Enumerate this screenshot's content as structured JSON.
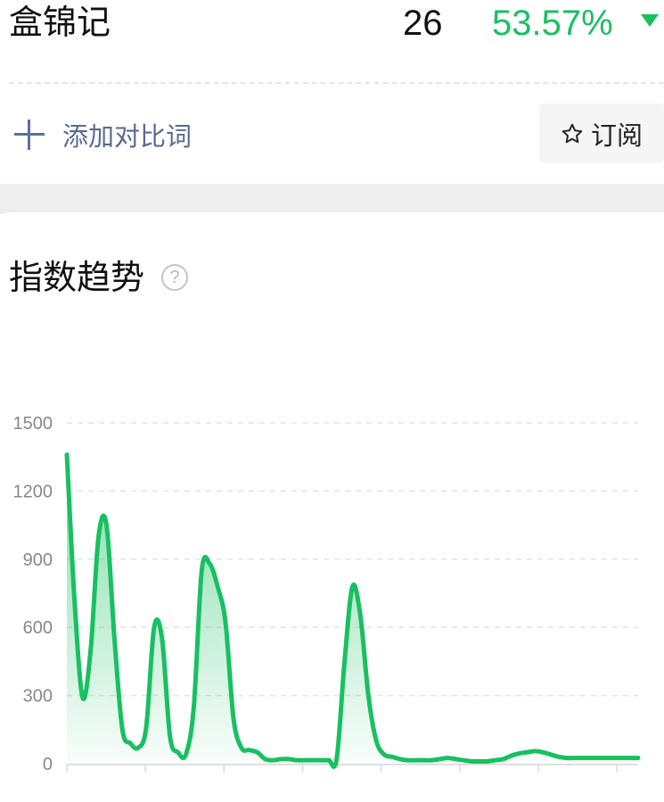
{
  "header": {
    "keyword": "盒锦记",
    "rank": "26",
    "change_percent": "53.57%",
    "trend_icon": "triangle-down-icon",
    "change_color": "#18c061"
  },
  "actions": {
    "add_compare_label": "添加对比词",
    "add_compare_icon": "plus-icon",
    "subscribe_label": "订阅",
    "subscribe_icon": "star-outline-icon"
  },
  "section": {
    "title": "指数趋势",
    "help_icon_text": "?"
  },
  "chart_data": {
    "type": "area",
    "title": "",
    "xlabel": "",
    "ylabel": "",
    "ylim": [
      0,
      1500
    ],
    "yticks": [
      "1500",
      "1200",
      "900",
      "600",
      "300",
      "0"
    ],
    "grid": true,
    "color": "#18c061",
    "x": [
      0,
      0.5,
      1,
      1.5,
      2,
      2.5,
      3,
      3.5,
      4,
      4.5,
      5,
      5.5,
      6,
      6.5,
      7,
      7.5,
      8,
      8.5,
      9,
      9.5,
      10,
      10.5,
      11,
      11.5,
      12,
      12.5,
      13,
      13.5,
      14,
      14.5,
      15,
      15.5,
      16,
      16.5,
      17,
      17.5,
      18,
      18.5,
      19,
      19.5,
      20,
      20.5,
      21,
      21.5,
      22,
      22.5,
      23,
      23.5,
      24,
      24.5,
      25,
      25.5,
      26,
      26.5,
      27,
      27.5,
      28,
      28.5,
      29,
      29.5,
      30,
      30.5,
      31,
      31.5,
      32,
      32.5,
      33,
      33.5,
      34,
      34.5,
      35,
      35.5,
      36
    ],
    "series": [
      {
        "values": [
          1360,
          700,
          290,
          500,
          1000,
          1050,
          550,
          150,
          90,
          70,
          160,
          600,
          550,
          120,
          50,
          40,
          250,
          850,
          880,
          780,
          620,
          200,
          70,
          60,
          50,
          20,
          15,
          20,
          20,
          15,
          15,
          15,
          15,
          15,
          20,
          450,
          780,
          650,
          300,
          100,
          40,
          30,
          20,
          15,
          15,
          15,
          15,
          20,
          25,
          20,
          15,
          10,
          10,
          10,
          15,
          20,
          35,
          45,
          50,
          55,
          50,
          40,
          30,
          25,
          25,
          25,
          25,
          25,
          25,
          25,
          25,
          25,
          25
        ]
      }
    ]
  }
}
